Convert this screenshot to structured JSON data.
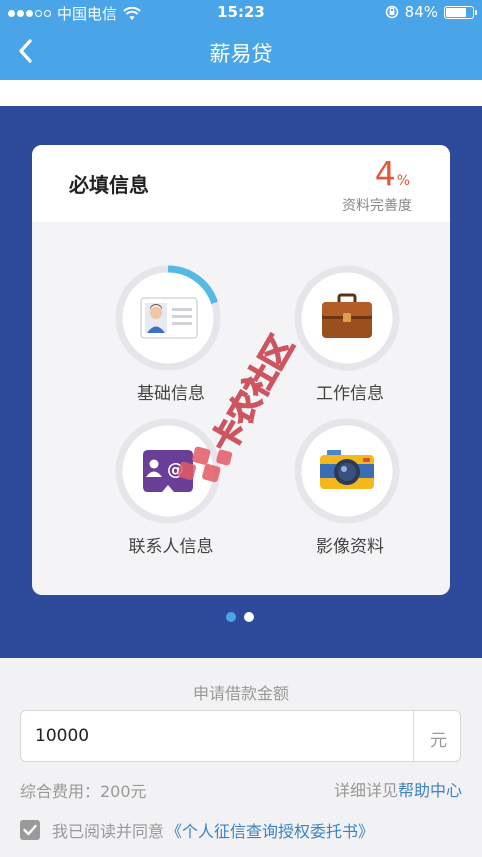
{
  "status_bar": {
    "carrier": "中国电信",
    "time": "15:23",
    "battery_text": "84%",
    "battery_level": 0.84
  },
  "nav": {
    "title": "薪易贷",
    "back_icon": "chevron-left-icon"
  },
  "card": {
    "title": "必填信息",
    "completion_value": "4",
    "completion_unit": "%",
    "completion_label": "资料完善度",
    "tiles": [
      {
        "label": "基础信息",
        "icon": "id-card-icon",
        "progress": 0.2
      },
      {
        "label": "工作信息",
        "icon": "briefcase-icon",
        "progress": 0
      },
      {
        "label": "联系人信息",
        "icon": "contact-card-icon",
        "progress": 0
      },
      {
        "label": "影像资料",
        "icon": "camera-icon",
        "progress": 0
      }
    ]
  },
  "pager": {
    "active": 0,
    "count": 2
  },
  "watermark": "卡农社区",
  "form": {
    "amount_label": "申请借款金额",
    "amount_value": "10000",
    "amount_unit": "元",
    "fee_text": "综合费用：200元",
    "help_prefix": "详细详见",
    "help_link": "帮助中心",
    "agree_text": "我已阅读并同意",
    "agree_link": "《个人征信查询授权委托书》",
    "agree_checked": true
  },
  "colors": {
    "primary_blue": "#4aa5e8",
    "panel_blue": "#2e4a9a",
    "accent_red": "#e4573a",
    "link_blue": "#3a83c6"
  }
}
